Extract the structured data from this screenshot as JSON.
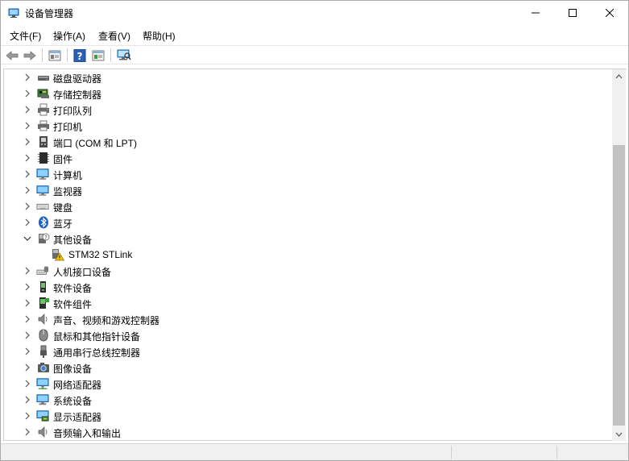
{
  "window": {
    "title": "设备管理器",
    "controls": {
      "minimize_icon": "minimize-icon",
      "maximize_icon": "maximize-icon",
      "close_icon": "close-icon"
    }
  },
  "menu": {
    "items": [
      {
        "label": "文件(F)"
      },
      {
        "label": "操作(A)"
      },
      {
        "label": "查看(V)"
      },
      {
        "label": "帮助(H)"
      }
    ]
  },
  "toolbar": {
    "buttons": [
      "back-icon",
      "forward-icon",
      "properties-icon",
      "help-icon",
      "update-driver-icon",
      "scan-hardware-icon"
    ]
  },
  "tree": {
    "items": [
      {
        "label": "磁盘驱动器",
        "icon": "disk-drive-icon",
        "expanded": false,
        "level": 0
      },
      {
        "label": "存储控制器",
        "icon": "storage-controller-icon",
        "expanded": false,
        "level": 0
      },
      {
        "label": "打印队列",
        "icon": "print-queue-icon",
        "expanded": false,
        "level": 0
      },
      {
        "label": "打印机",
        "icon": "printer-icon",
        "expanded": false,
        "level": 0
      },
      {
        "label": "端口 (COM 和 LPT)",
        "icon": "port-icon",
        "expanded": false,
        "level": 0
      },
      {
        "label": "固件",
        "icon": "firmware-icon",
        "expanded": false,
        "level": 0
      },
      {
        "label": "计算机",
        "icon": "computer-icon",
        "expanded": false,
        "level": 0
      },
      {
        "label": "监视器",
        "icon": "monitor-icon",
        "expanded": false,
        "level": 0
      },
      {
        "label": "键盘",
        "icon": "keyboard-icon",
        "expanded": false,
        "level": 0
      },
      {
        "label": "蓝牙",
        "icon": "bluetooth-icon",
        "expanded": false,
        "level": 0
      },
      {
        "label": "其他设备",
        "icon": "other-devices-icon",
        "expanded": true,
        "level": 0
      },
      {
        "label": "STM32 STLink",
        "icon": "warning-device-icon",
        "expanded": null,
        "level": 1
      },
      {
        "label": "人机接口设备",
        "icon": "hid-icon",
        "expanded": false,
        "level": 0
      },
      {
        "label": "软件设备",
        "icon": "software-device-icon",
        "expanded": false,
        "level": 0
      },
      {
        "label": "软件组件",
        "icon": "software-component-icon",
        "expanded": false,
        "level": 0
      },
      {
        "label": "声音、视频和游戏控制器",
        "icon": "sound-icon",
        "expanded": false,
        "level": 0
      },
      {
        "label": "鼠标和其他指针设备",
        "icon": "mouse-icon",
        "expanded": false,
        "level": 0
      },
      {
        "label": "通用串行总线控制器",
        "icon": "usb-icon",
        "expanded": false,
        "level": 0
      },
      {
        "label": "图像设备",
        "icon": "camera-icon",
        "expanded": false,
        "level": 0
      },
      {
        "label": "网络适配器",
        "icon": "network-adapter-icon",
        "expanded": false,
        "level": 0
      },
      {
        "label": "系统设备",
        "icon": "system-device-icon",
        "expanded": false,
        "level": 0
      },
      {
        "label": "显示适配器",
        "icon": "display-adapter-icon",
        "expanded": false,
        "level": 0
      },
      {
        "label": "音频输入和输出",
        "icon": "audio-io-icon",
        "expanded": false,
        "level": 0
      }
    ]
  }
}
